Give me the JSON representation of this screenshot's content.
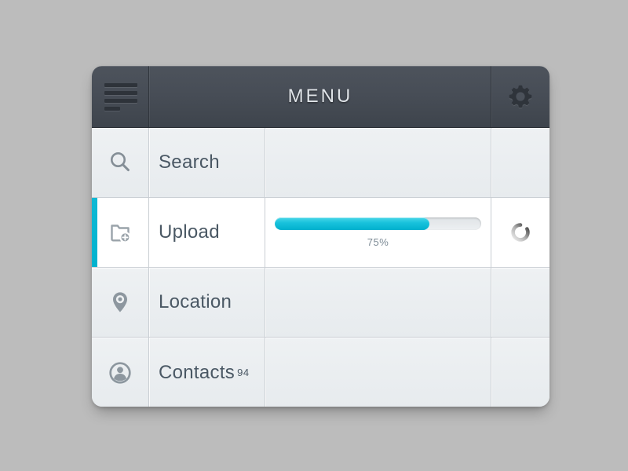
{
  "header": {
    "title": "MENU",
    "menu_icon": "hamburger-icon",
    "settings_icon": "gear-icon"
  },
  "colors": {
    "accent": "#00b2ce",
    "header_bg": "#474d56",
    "panel_bg": "#eceff1",
    "row_text": "#4a5864",
    "page_bg": "#bcbcbc"
  },
  "rows": [
    {
      "id": "search",
      "label": "Search",
      "icon": "search-icon",
      "active": false,
      "badge": "",
      "extra": ""
    },
    {
      "id": "upload",
      "label": "Upload",
      "icon": "folder-add-icon",
      "active": true,
      "badge": "",
      "extra": "loading-spinner-icon"
    },
    {
      "id": "location",
      "label": "Location",
      "icon": "map-pin-icon",
      "active": false,
      "badge": "",
      "extra": ""
    },
    {
      "id": "contacts",
      "label": "Contacts",
      "icon": "contact-avatar-icon",
      "active": false,
      "badge": "94",
      "extra": ""
    }
  ],
  "upload": {
    "progress_percent": 75,
    "progress_label": "75%"
  }
}
